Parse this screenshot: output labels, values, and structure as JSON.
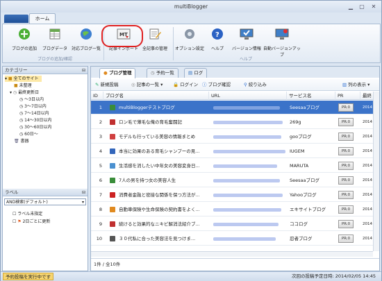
{
  "window": {
    "title": "multiBlogger",
    "home_tab": "ホーム"
  },
  "ribbon": {
    "buttons": [
      "ブログの追加",
      "ブログデータ",
      "対応ブログ一覧",
      "記事インポート",
      "全記事の管理",
      "オプション設定",
      "ヘルプ",
      "バージョン情報",
      "自動バージョンアップ"
    ],
    "groups": [
      "ブログの追加/確認",
      "ヘルプ"
    ]
  },
  "categories": {
    "header": "カテゴリー",
    "items": [
      "全てのサイト",
      "未整理",
      "最終更新日",
      "～3日以内",
      "3～7日以内",
      "7～14日以内",
      "14～30日以内",
      "30～60日以内",
      "60日～",
      "書器"
    ]
  },
  "labels": {
    "header": "ラベル",
    "selected": "AND検索(デフォルト)",
    "items": [
      "ラベル未指定",
      "2日ごとに更新"
    ]
  },
  "tabs": [
    "ブログ管理",
    "予約一覧",
    "ログ"
  ],
  "toolbar": {
    "new_post": "新規投稿",
    "post_list": "記事の一覧",
    "login": "ログイン",
    "check": "ブログ確認",
    "filter": "絞り込み",
    "columns": "列の表示"
  },
  "grid": {
    "headers": [
      "ID",
      "ブログ名",
      "URL",
      "サービス名",
      "PR",
      "最終"
    ],
    "rows": [
      {
        "id": "1",
        "name": "multiBloggerテストブログ",
        "service": "Seesaaブログ",
        "pr": "PR:0",
        "last": "2014",
        "color": "#3a8d3a"
      },
      {
        "id": "2",
        "name": "ロン毛で薄毛な俺の育毛奮闘記",
        "service": "269g",
        "pr": "PR:0",
        "last": "2014",
        "color": "#c03030"
      },
      {
        "id": "3",
        "name": "モデルも行っている美容の情報まとめ",
        "service": "gooブログ",
        "pr": "PR:0",
        "last": "2014",
        "color": "#d04040"
      },
      {
        "id": "4",
        "name": "本当に効果のある育毛シャンプーの見...",
        "service": "IUGEM",
        "pr": "PR:0",
        "last": "2014",
        "color": "#3366bb"
      },
      {
        "id": "5",
        "name": "生活感を消したい中年女の美容変身日...",
        "service": "MARUTA",
        "pr": "PR:0",
        "last": "2014",
        "color": "#4a90d0"
      },
      {
        "id": "6",
        "name": "7人の男を持つ女の美容人生",
        "service": "Seesaaブログ",
        "pr": "PR:0",
        "last": "2014",
        "color": "#3a8d3a"
      },
      {
        "id": "7",
        "name": "消費者金融と密接な関係を保つ方法が...",
        "service": "Yahooブログ",
        "pr": "PR:0",
        "last": "2014",
        "color": "#cc2222"
      },
      {
        "id": "8",
        "name": "自動車保険や生命保険の契約書をよく...",
        "service": "エキサイトブログ",
        "pr": "PR:0",
        "last": "2014",
        "color": "#e08a20"
      },
      {
        "id": "9",
        "name": "続けると効果的なニキビ解消法紹介ブ...",
        "service": "ココログ",
        "pr": "PR:0",
        "last": "2014",
        "color": "#c03030"
      },
      {
        "id": "10",
        "name": "３０代私に合った美容法を見つけま...",
        "service": "忍者ブログ",
        "pr": "PR:0",
        "last": "2014",
        "color": "#555555"
      }
    ]
  },
  "footer": {
    "count": "1件 / 全10件"
  },
  "status": {
    "left": "予約投稿を実行中です",
    "right": "次回の投稿予定日時: 2014/02/05 14:45"
  }
}
